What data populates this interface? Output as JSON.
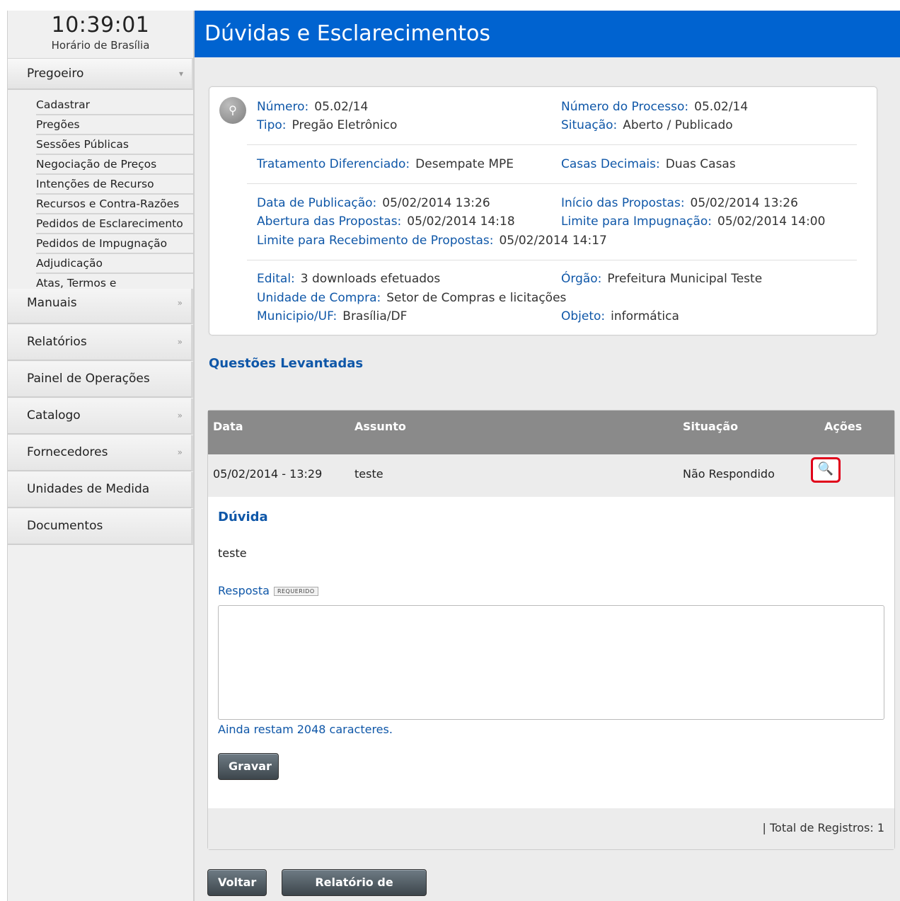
{
  "clock": {
    "time": "10:39:01",
    "label": "Horário de Brasília"
  },
  "sidebar": {
    "pregoeiro": {
      "label": "Pregoeiro",
      "arrow": "▾"
    },
    "submenu": [
      "Cadastrar",
      "Pregões",
      "Sessões Públicas",
      "Negociação de Preços",
      "Intenções de Recurso",
      "Recursos e Contra-Razões",
      "Pedidos de Esclarecimento",
      "Pedidos de Impugnação",
      "Adjudicação",
      "Atas, Termos e"
    ],
    "blocks": [
      {
        "label": "Manuais",
        "arrow": "»"
      },
      {
        "label": "Relatórios",
        "arrow": "»"
      },
      {
        "label": "Painel de Operações",
        "arrow": ""
      },
      {
        "label": "Catalogo",
        "arrow": "»"
      },
      {
        "label": "Fornecedores",
        "arrow": "»"
      },
      {
        "label": "Unidades de Medida",
        "arrow": ""
      },
      {
        "label": "Documentos",
        "arrow": ""
      }
    ]
  },
  "header": {
    "title": "Dúvidas e Esclarecimentos"
  },
  "info": {
    "numero": {
      "label": "Número:",
      "value": "05.02/14"
    },
    "processo": {
      "label": "Número do Processo:",
      "value": "05.02/14"
    },
    "tipo": {
      "label": "Tipo:",
      "value": "Pregão Eletrônico"
    },
    "situacao": {
      "label": "Situação:",
      "value": "Aberto / Publicado"
    },
    "tratamento": {
      "label": "Tratamento Diferenciado:",
      "value": "Desempate MPE"
    },
    "casas": {
      "label": "Casas Decimais:",
      "value": "Duas Casas"
    },
    "publicacao": {
      "label": "Data de Publicação:",
      "value": "05/02/2014 13:26"
    },
    "inicio": {
      "label": "Início das Propostas:",
      "value": "05/02/2014 13:26"
    },
    "abertura": {
      "label": "Abertura das Propostas:",
      "value": "05/02/2014 14:18"
    },
    "impugnacao": {
      "label": "Limite para Impugnação:",
      "value": "05/02/2014 14:00"
    },
    "recebimento": {
      "label": "Limite para Recebimento de Propostas:",
      "value": "05/02/2014 14:17"
    },
    "edital": {
      "label": "Edital:",
      "value": "3 downloads efetuados"
    },
    "orgao": {
      "label": "Órgão:",
      "value": "Prefeitura Municipal Teste"
    },
    "unidade": {
      "label": "Unidade de Compra:",
      "value": "Setor de Compras e licitações"
    },
    "municipio": {
      "label": "Municipio/UF:",
      "value": "Brasília/DF"
    },
    "objeto": {
      "label": "Objeto:",
      "value": "informática"
    }
  },
  "questions": {
    "title": "Questões Levantadas",
    "columns": {
      "data": "Data",
      "assunto": "Assunto",
      "situacao": "Situação",
      "acoes": "Ações"
    },
    "row": {
      "data": "05/02/2014 - 13:29",
      "assunto": "teste",
      "situacao": "Não Respondido",
      "action_icon": "magnifier-icon"
    },
    "duvida_title": "Dúvida",
    "duvida_text": "teste",
    "resposta_label": "Resposta",
    "required_badge": "REQUERIDO",
    "resposta_value": "",
    "counter": "Ainda restam 2048 caracteres.",
    "gravar": "Gravar",
    "total": "| Total de Registros: 1"
  },
  "footer_buttons": {
    "voltar": "Voltar",
    "relatorio": "Relatório de Dúvidas"
  }
}
